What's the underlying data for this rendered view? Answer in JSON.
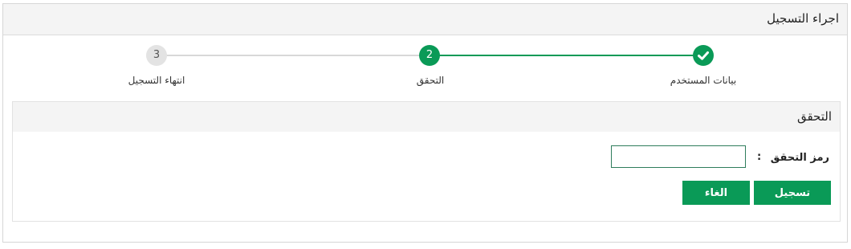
{
  "panel": {
    "title": "اجراء التسجيل"
  },
  "steps": [
    {
      "label": "بيانات المستخدم",
      "number": "",
      "state": "done",
      "icon": "check-icon"
    },
    {
      "label": "التحقق",
      "number": "2",
      "state": "active"
    },
    {
      "label": "انتهاء التسجيل",
      "number": "3",
      "state": "pending"
    }
  ],
  "verification": {
    "title": "التحقق",
    "code_label": "رمز التحقق",
    "colon": ":",
    "code_value": "",
    "register_label": "تسجيل",
    "cancel_label": "الغاء"
  },
  "colors": {
    "accent": "#0a9a57",
    "inactive": "#e3e3e3",
    "header_bg": "#f4f4f4"
  }
}
